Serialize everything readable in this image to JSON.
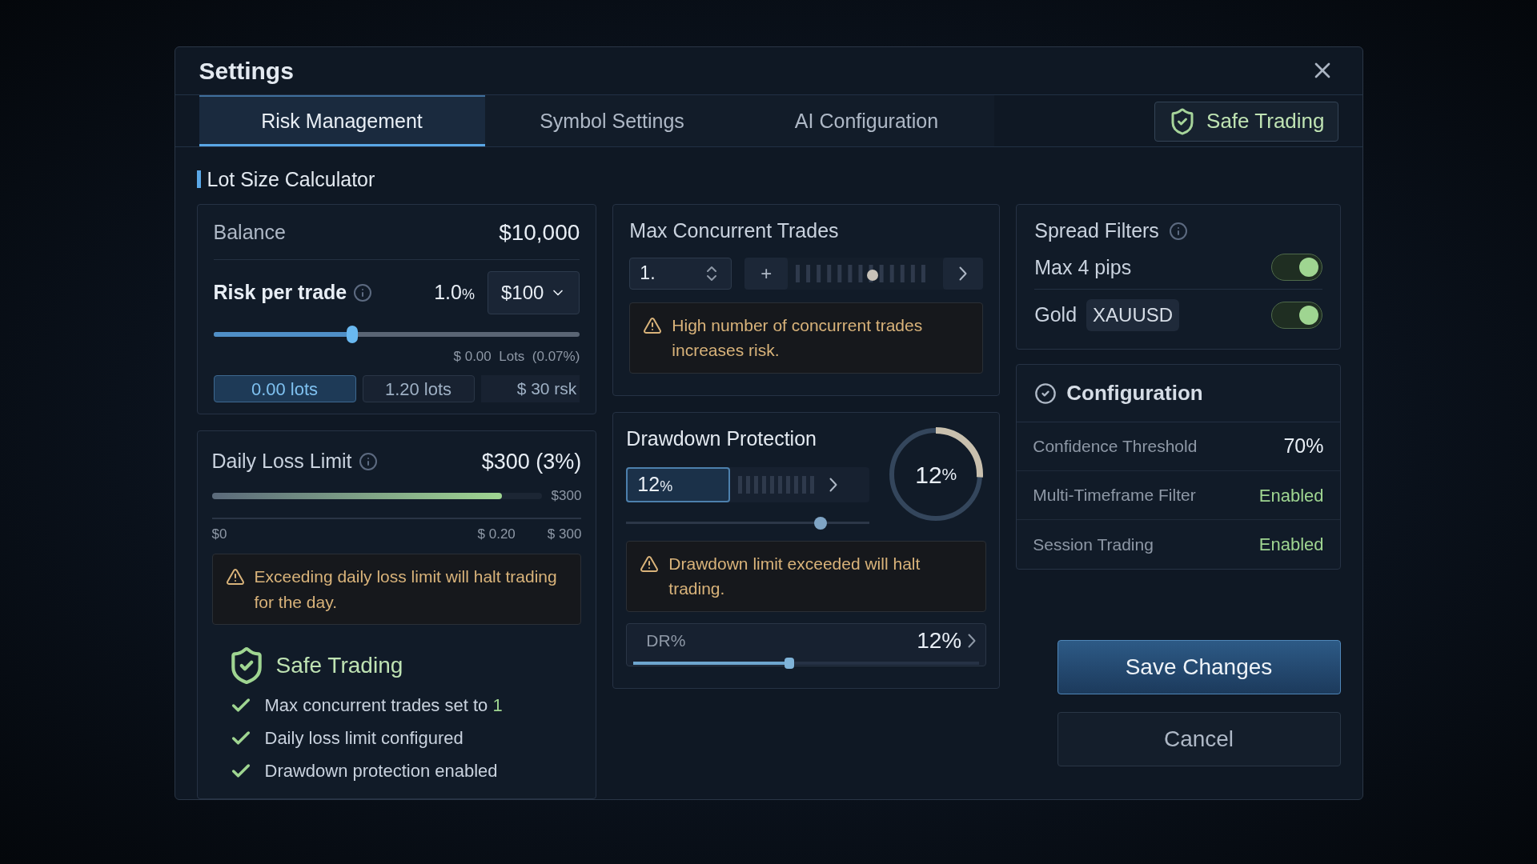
{
  "window": {
    "title": "Settings"
  },
  "tabs": [
    {
      "label": "Risk Management",
      "selected": true
    },
    {
      "label": "Symbol Settings",
      "selected": false
    },
    {
      "label": "AI Configuration",
      "selected": false
    }
  ],
  "status_badge": {
    "label": "Safe Trading"
  },
  "section_title": "Lot Size Calculator",
  "balance": {
    "label": "Balance",
    "value": "$10,000"
  },
  "risk_per_trade": {
    "label": "Risk per trade",
    "percent": "1.0",
    "unit": "%",
    "amount": "$100",
    "level": 0.38,
    "note": "$ 0.00  Lots  (0.07%)",
    "lot_options": [
      {
        "label": "0.00 lots",
        "selected": true
      },
      {
        "label": "1.20 lots",
        "selected": false
      }
    ],
    "risk_text": "$ 30 rsk"
  },
  "daily_loss": {
    "label": "Daily Loss Limit",
    "value": "$300 (3%)",
    "level": 0.88,
    "end_label": "$300",
    "scale": [
      "$0",
      "$ 0.20",
      "$ 300"
    ],
    "warning": "Exceeding daily loss limit will halt trading for the day."
  },
  "safe_trading": {
    "title": "Safe Trading",
    "items": [
      {
        "text": "Max concurrent trades set to",
        "value": "1",
        "checked": true
      },
      {
        "text": "Daily loss limit configured",
        "checked": true
      },
      {
        "text": "Drawdown protection enabled",
        "checked": true
      }
    ]
  },
  "max_trades": {
    "title": "Max Concurrent Trades",
    "value": "1.",
    "step_label": "+",
    "level": 0.55,
    "warning": "High number of concurrent trades increases risk."
  },
  "drawdown": {
    "title": "Drawdown Protection",
    "value": "12",
    "unit": "%",
    "level": 0.8,
    "gauge": {
      "label": "12",
      "unit": "%",
      "level": 0.26
    },
    "warning": "Drawdown limit exceeded will halt trading.",
    "dr": {
      "label": "DR%",
      "value": "12%",
      "level": 0.45
    }
  },
  "spread_filters": {
    "title": "Spread Filters",
    "rows": [
      {
        "label": "Max 4 pips",
        "on": true
      },
      {
        "label": "Gold",
        "tag": "XAUUSD",
        "on": true
      }
    ]
  },
  "configuration": {
    "title": "Configuration",
    "rows": [
      {
        "label": "Confidence Threshold",
        "value": "70%",
        "kind": "number"
      },
      {
        "label": "Multi-Timeframe Filter",
        "value": "Enabled",
        "kind": "status"
      },
      {
        "label": "Session Trading",
        "value": "Enabled",
        "kind": "status"
      }
    ]
  },
  "buttons": [
    {
      "label": "Save Changes",
      "kind": "primary"
    },
    {
      "label": "Cancel",
      "kind": "secondary"
    }
  ]
}
